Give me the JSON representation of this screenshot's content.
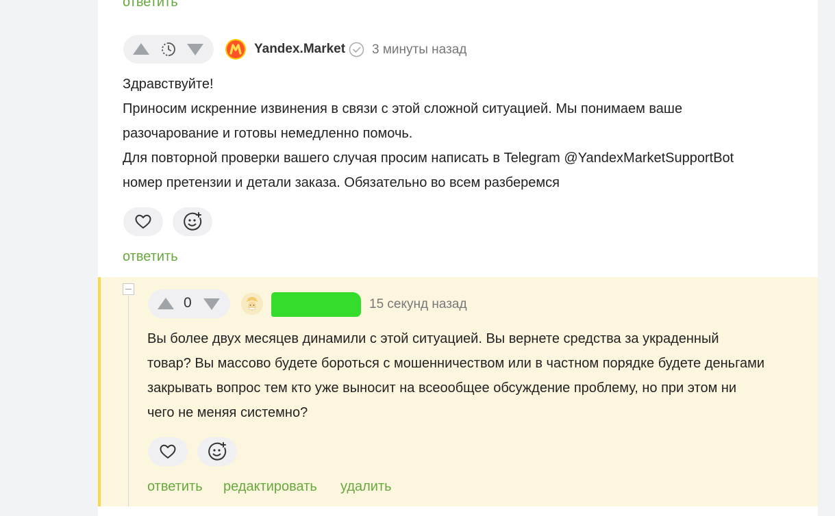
{
  "top_comment_reply": "ответить",
  "comment1": {
    "author": "Yandex.Market",
    "time": "3 минуты назад",
    "rating_icon": "pending-clock",
    "lines": [
      "Здравствуйте!",
      "Приносим искренние извинения в связи с этой сложной ситуацией. Мы понимаем ваше",
      "разочарование и готовы немедленно помочь.",
      "Для повторной проверки вашего случая просим написать в Telegram @YandexMarketSupportBot",
      "номер претензии и детали заказа. Обязательно во всем разберемся"
    ],
    "reply_label": "ответить"
  },
  "comment2": {
    "rating": "0",
    "time": "15 секунд назад",
    "lines": [
      "Вы более двух месяцев динамили с этой ситуацией. Вы вернете средства за украденный",
      "товар? Вы массово будете бороться с мошенничеством или в частном порядке будете деньгами",
      "закрывать вопрос тем кто уже выносит на всеообщее обсуждение проблему, но при этом ни",
      "чего не меняя системно?"
    ],
    "actions": {
      "reply": "ответить",
      "edit": "редактировать",
      "delete": "удалить"
    }
  },
  "colors": {
    "link_green": "#67a83e",
    "highlight_bg": "#fdf6df",
    "highlight_border": "#f6d84d",
    "redaction": "#36dc2c"
  }
}
